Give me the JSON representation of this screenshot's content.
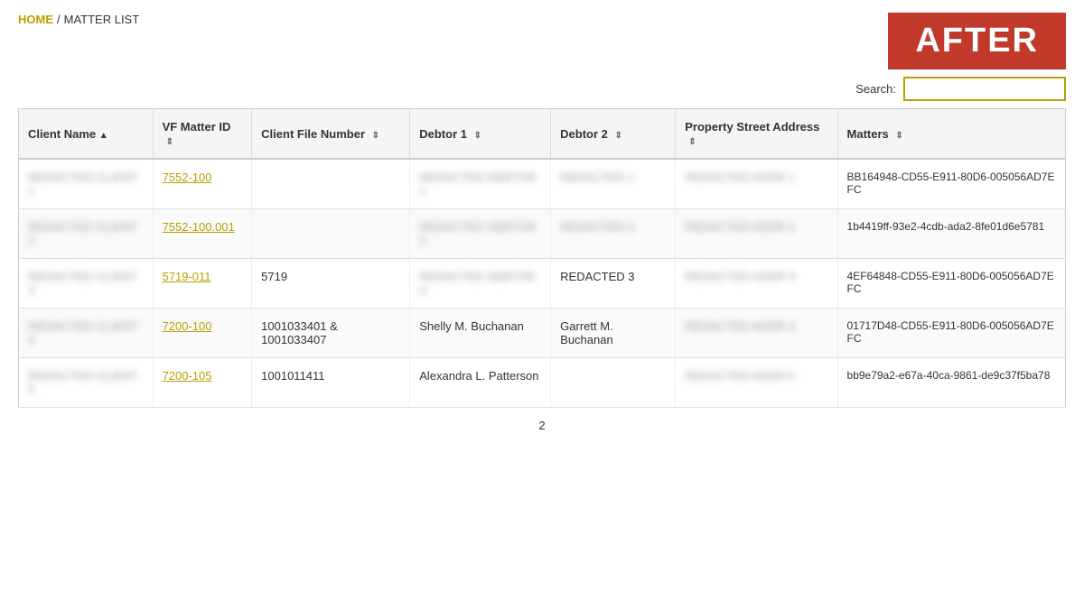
{
  "breadcrumb": {
    "home": "HOME",
    "separator": "/",
    "current": "MATTER LIST"
  },
  "after_badge": "AFTER",
  "search": {
    "label": "Search:",
    "placeholder": ""
  },
  "table": {
    "columns": [
      {
        "id": "client_name",
        "label": "Client Name",
        "sortable": true,
        "sort_direction": "asc"
      },
      {
        "id": "vf_matter_id",
        "label": "VF Matter ID",
        "sortable": true
      },
      {
        "id": "client_file_number",
        "label": "Client File Number",
        "sortable": true
      },
      {
        "id": "debtor1",
        "label": "Debtor 1",
        "sortable": true
      },
      {
        "id": "debtor2",
        "label": "Debtor 2",
        "sortable": true
      },
      {
        "id": "property_street_address",
        "label": "Property Street Address",
        "sortable": true
      },
      {
        "id": "matters",
        "label": "Matters",
        "sortable": true
      }
    ],
    "rows": [
      {
        "client_name": "REDACTED CLIENT 1",
        "vf_matter_id": "7552-100",
        "client_file_number": "",
        "debtor1": "REDACTED DEBTOR 1",
        "debtor2": "REDACTED 1",
        "property_street_address": "REDACTED ADDR 1",
        "matters": "BB164948-CD55-E911-80D6-005056AD7EFC"
      },
      {
        "client_name": "REDACTED CLIENT 2",
        "vf_matter_id": "7552-100.001",
        "client_file_number": "",
        "debtor1": "REDACTED DEBTOR 2",
        "debtor2": "REDACTED 2",
        "property_street_address": "REDACTED ADDR 2",
        "matters": "1b4419ff-93e2-4cdb-ada2-8fe01d6e5781"
      },
      {
        "client_name": "REDACTED CLIENT 3",
        "vf_matter_id": "5719-011",
        "client_file_number": "5719",
        "debtor1": "REDACTED DEBTOR 3",
        "debtor2": "REDACTED 3",
        "property_street_address": "REDACTED ADDR 3",
        "matters": "4EF64848-CD55-E911-80D6-005056AD7EFC"
      },
      {
        "client_name": "REDACTED CLIENT 4",
        "vf_matter_id": "7200-100",
        "client_file_number": "1001033401 & 1001033407",
        "debtor1": "Shelly M. Buchanan",
        "debtor2": "Garrett M. Buchanan",
        "property_street_address": "REDACTED ADDR 4",
        "matters": "01717D48-CD55-E911-80D6-005056AD7EFC"
      },
      {
        "client_name": "REDACTED CLIENT 5",
        "vf_matter_id": "7200-105",
        "client_file_number": "1001011411",
        "debtor1": "Alexandra L. Patterson",
        "debtor2": "",
        "property_street_address": "REDACTED ADDR 5",
        "matters": "bb9e79a2-e67a-40ca-9861-de9c37f5ba78"
      }
    ]
  },
  "pagination": {
    "current_page": "2"
  }
}
